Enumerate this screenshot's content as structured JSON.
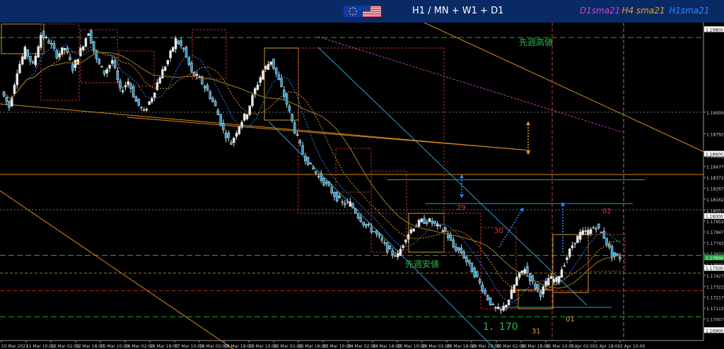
{
  "header": {
    "pair_title": "H1 / MN + W1 + D1",
    "sma_d1": "D1sma21",
    "sma_h4": "H4 sma21",
    "sma_h1": "H1sma21",
    "colors": {
      "d1": "#d03fd0",
      "h4": "#e0a020",
      "h1": "#2a8cff"
    },
    "flags": [
      "eu-flag-icon",
      "us-flag-icon"
    ]
  },
  "chart_data": {
    "type": "candlestick",
    "symbol_flags": [
      "EUR",
      "USD"
    ],
    "y_axis_ticks": [
      "1.19000",
      "1.18792",
      "1.18582",
      "1.18477",
      "1.18372",
      "1.18267",
      "1.18162",
      "1.18057",
      "1.17952",
      "1.17847",
      "1.17742",
      "1.17637",
      "1.17532",
      "1.17427",
      "1.17322",
      "1.17217",
      "1.17112",
      "1.17007",
      "1.16902"
    ],
    "ylim": [
      1.168,
      1.1985
    ],
    "x_axis_ticks": [
      "10 Mar 2021",
      "11 Mar 10:00",
      "12 Mar 02:00",
      "12 Mar 18:00",
      "15 Mar 10:00",
      "16 Mar 02:00",
      "16 Mar 18:00",
      "17 Mar 10:00",
      "18 Mar 02:00",
      "18 Mar 18:00",
      "19 Mar 10:00",
      "22 Mar 02:00",
      "22 Mar 18:00",
      "23 Mar 10:00",
      "24 Mar 02:00",
      "24 Mar 18:00",
      "25 Mar 10:00",
      "26 Mar 02:00",
      "26 Mar 18:00",
      "29 Mar 10:00",
      "30 Mar 02:00",
      "30 Mar 18:00",
      "31 Mar 10:00",
      "1 Apr 02:00",
      "1 Apr 18:00",
      "2 Apr 10:00"
    ],
    "price_tags": {
      "last_price": "1.17600",
      "levels": [
        "1.19800",
        "1.18600",
        "1.18000",
        "1.17500",
        "1.16900"
      ]
    },
    "annotations": {
      "last_week_high": "先週高値",
      "last_week_low": "先週安値",
      "round_level": "1．170",
      "day_29": "29",
      "day_30": "30",
      "day_31": "31",
      "day_01": "01",
      "day_02": "02"
    },
    "price_path": [
      [
        0,
        1.192
      ],
      [
        3,
        1.1905
      ],
      [
        6,
        1.194
      ],
      [
        9,
        1.196
      ],
      [
        12,
        1.1945
      ],
      [
        15,
        1.1975
      ],
      [
        18,
        1.1968
      ],
      [
        21,
        1.1955
      ],
      [
        24,
        1.1962
      ],
      [
        27,
        1.1942
      ],
      [
        30,
        1.196
      ],
      [
        33,
        1.1978
      ],
      [
        36,
        1.195
      ],
      [
        39,
        1.1938
      ],
      [
        42,
        1.195
      ],
      [
        45,
        1.192
      ],
      [
        48,
        1.193
      ],
      [
        51,
        1.191
      ],
      [
        54,
        1.19
      ],
      [
        57,
        1.1915
      ],
      [
        60,
        1.1935
      ],
      [
        63,
        1.195
      ],
      [
        66,
        1.197
      ],
      [
        69,
        1.196
      ],
      [
        72,
        1.1938
      ],
      [
        75,
        1.1932
      ],
      [
        78,
        1.192
      ],
      [
        81,
        1.1905
      ],
      [
        84,
        1.1882
      ],
      [
        87,
        1.187
      ],
      [
        90,
        1.1888
      ],
      [
        93,
        1.19
      ],
      [
        96,
        1.1922
      ],
      [
        99,
        1.194
      ],
      [
        102,
        1.195
      ],
      [
        105,
        1.193
      ],
      [
        108,
        1.1908
      ],
      [
        111,
        1.1882
      ],
      [
        114,
        1.186
      ],
      [
        117,
        1.1848
      ],
      [
        120,
        1.1838
      ],
      [
        123,
        1.183
      ],
      [
        126,
        1.182
      ],
      [
        129,
        1.1812
      ],
      [
        132,
        1.1812
      ],
      [
        135,
        1.18
      ],
      [
        138,
        1.179
      ],
      [
        141,
        1.1785
      ],
      [
        144,
        1.1775
      ],
      [
        147,
        1.1765
      ],
      [
        150,
        1.1762
      ],
      [
        153,
        1.178
      ],
      [
        156,
        1.179
      ],
      [
        159,
        1.1795
      ],
      [
        162,
        1.1795
      ],
      [
        165,
        1.179
      ],
      [
        168,
        1.1785
      ],
      [
        171,
        1.177
      ],
      [
        174,
        1.1765
      ],
      [
        177,
        1.1752
      ],
      [
        180,
        1.174
      ],
      [
        183,
        1.1725
      ],
      [
        186,
        1.1712
      ],
      [
        189,
        1.1708
      ],
      [
        192,
        1.172
      ],
      [
        195,
        1.174
      ],
      [
        198,
        1.175
      ],
      [
        201,
        1.1735
      ],
      [
        204,
        1.1725
      ],
      [
        207,
        1.174
      ],
      [
        210,
        1.1738
      ],
      [
        213,
        1.1755
      ],
      [
        216,
        1.1772
      ],
      [
        219,
        1.1783
      ],
      [
        222,
        1.1785
      ],
      [
        225,
        1.179
      ],
      [
        228,
        1.178
      ],
      [
        231,
        1.1762
      ],
      [
        234,
        1.176
      ]
    ]
  }
}
